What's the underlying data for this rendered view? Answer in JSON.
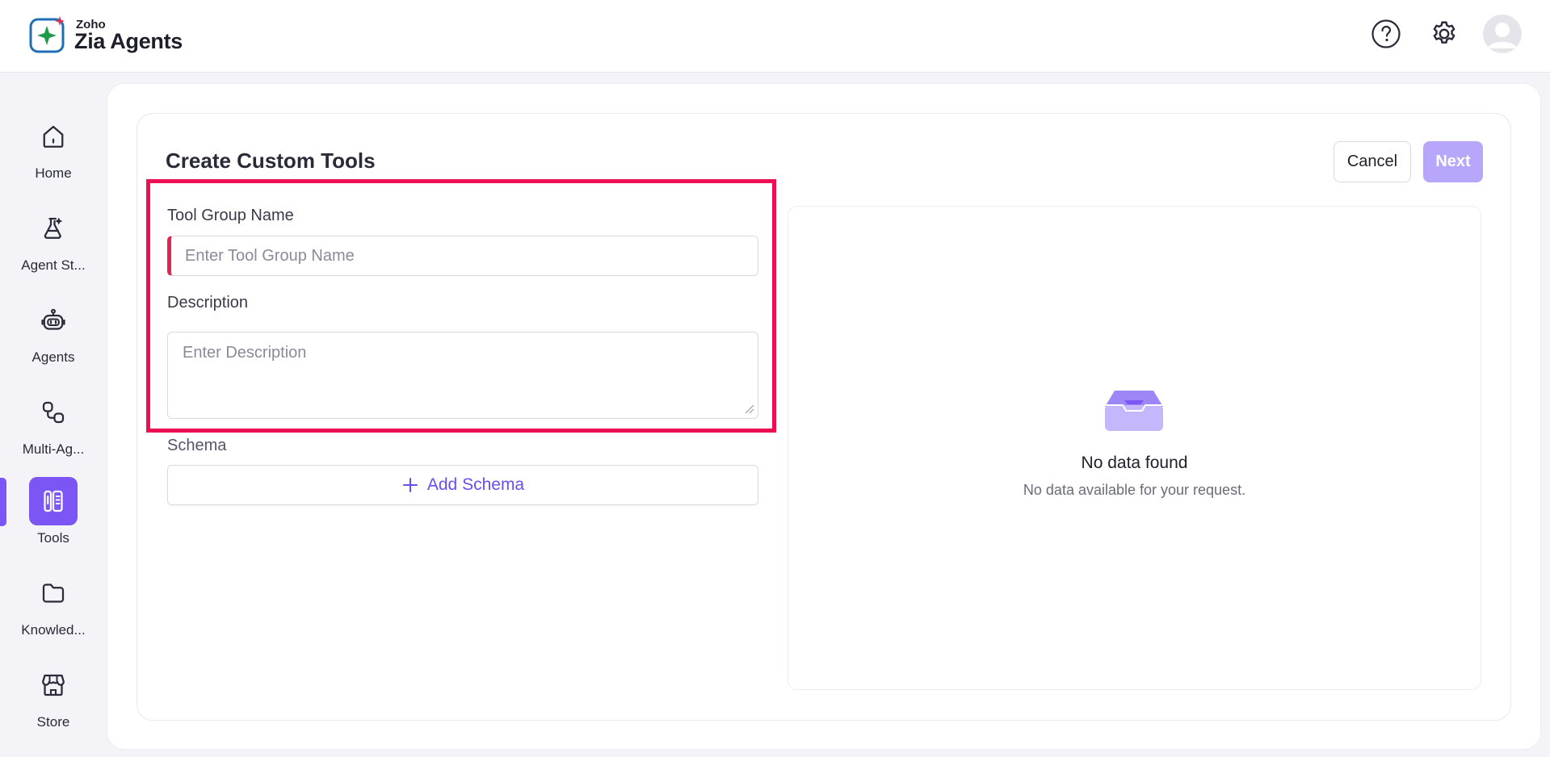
{
  "app": {
    "brand_small": "Zoho",
    "brand_name": "Zia Agents",
    "accent_color": "#7b56f5",
    "highlight_color": "#ec0f52"
  },
  "header": {
    "icons": [
      "help-icon",
      "settings-icon",
      "avatar-icon"
    ]
  },
  "sidebar": {
    "items": [
      {
        "label": "Home",
        "icon": "home-icon"
      },
      {
        "label": "Agent St...",
        "icon": "agent-studio-icon"
      },
      {
        "label": "Agents",
        "icon": "robot-icon"
      },
      {
        "label": "Multi-Ag...",
        "icon": "multi-agent-icon"
      },
      {
        "label": "Tools",
        "icon": "tools-icon",
        "active": true
      },
      {
        "label": "Knowled...",
        "icon": "folder-icon"
      },
      {
        "label": "Store",
        "icon": "store-icon"
      }
    ]
  },
  "page": {
    "title": "Create Custom Tools",
    "cancel_label": "Cancel",
    "next_label": "Next"
  },
  "form": {
    "group_name_label": "Tool Group Name",
    "group_name_placeholder": "Enter Tool Group Name",
    "group_name_value": "",
    "description_label": "Description",
    "description_placeholder": "Enter Description",
    "description_value": "",
    "schema_label": "Schema",
    "add_schema_label": "Add Schema"
  },
  "empty_state": {
    "title": "No data found",
    "subtitle": "No data available for your request.",
    "icon": "inbox-tray-icon"
  }
}
